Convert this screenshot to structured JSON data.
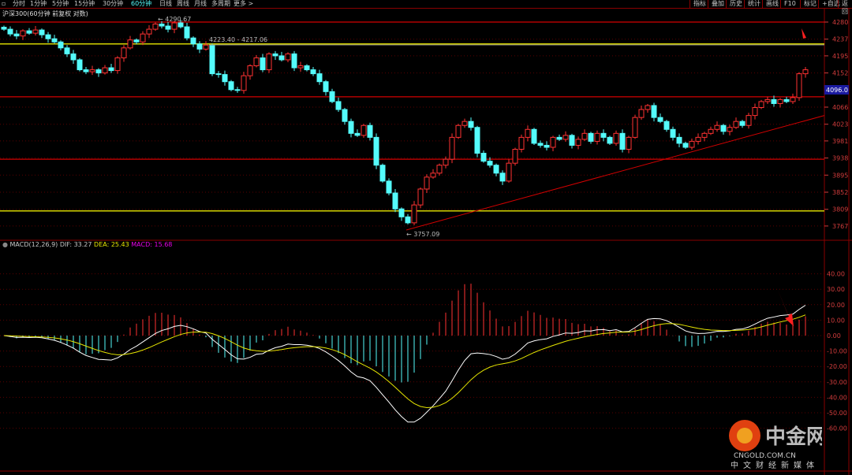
{
  "toolbar": {
    "periods": [
      "分时",
      "1分钟",
      "5分钟",
      "15分钟",
      "30分钟",
      "60分钟",
      "日线",
      "周线",
      "月线",
      "多周期",
      "更多 >"
    ],
    "active": "60分钟",
    "right": [
      "指标",
      "叠加",
      "历史",
      "统计",
      "画线",
      "F10",
      "标记",
      "+自选",
      "返回"
    ]
  },
  "title": "沪深300(60分钟 前复权 对数)",
  "macd_legend": {
    "name": "MACD(12,26,9)",
    "dif": "DIF: 33.27",
    "dea": "DEA: 25.43",
    "macd": "MACD: 15.68"
  },
  "colors": {
    "up": "#ff3232",
    "down": "#54fcfc",
    "dif": "#ffffff",
    "dea": "#e6e600",
    "level_yellow": "#d2d200",
    "level_red": "#d20000",
    "macd_label": "#e600e6"
  },
  "watermark": {
    "brand": "中金网",
    "domain": "CNGOLD.COM.CN",
    "tagline": "中文财经新媒体"
  },
  "chart_data": [
    {
      "type": "candlestick",
      "title": "沪深300(60分钟 前复权 对数)",
      "ylim": [
        3745,
        4300
      ],
      "yticks": [
        4280,
        4237,
        4195,
        4152,
        4066,
        4023,
        3981,
        3938,
        3895,
        3852,
        3809,
        3767
      ],
      "current_price_label": "4096.0",
      "annotations": {
        "high": "4290.67",
        "low": "3757.09",
        "range": "4223.40 - 4217.06"
      },
      "horizontal_levels": {
        "red": [
          4280,
          4092,
          3935
        ],
        "yellow": [
          4225,
          3805
        ]
      },
      "trendline": {
        "from_price": 3757,
        "to_price": 4045
      },
      "closes": [
        4262,
        4250,
        4245,
        4258,
        4252,
        4260,
        4248,
        4238,
        4230,
        4215,
        4200,
        4185,
        4160,
        4155,
        4160,
        4152,
        4165,
        4158,
        4190,
        4215,
        4235,
        4230,
        4250,
        4262,
        4275,
        4270,
        4262,
        4278,
        4268,
        4240,
        4225,
        4212,
        4222,
        4150,
        4148,
        4130,
        4110,
        4108,
        4145,
        4170,
        4190,
        4160,
        4200,
        4195,
        4185,
        4200,
        4165,
        4170,
        4160,
        4150,
        4130,
        4105,
        4080,
        4060,
        4030,
        4000,
        3995,
        4020,
        3990,
        3920,
        3880,
        3850,
        3810,
        3790,
        3775,
        3820,
        3860,
        3890,
        3900,
        3920,
        3935,
        3990,
        4020,
        4030,
        4015,
        3950,
        3930,
        3920,
        3900,
        3880,
        3925,
        3960,
        3990,
        4010,
        3975,
        3970,
        3965,
        3990,
        3985,
        3995,
        3970,
        3985,
        4000,
        3980,
        4000,
        3990,
        3975,
        4000,
        3960,
        3990,
        4040,
        4060,
        4070,
        4040,
        4030,
        4010,
        3990,
        3975,
        3965,
        3980,
        3990,
        4000,
        4010,
        4020,
        4005,
        4015,
        4030,
        4020,
        4045,
        4065,
        4080,
        4085,
        4075,
        4085,
        4080,
        4090,
        4150,
        4160
      ]
    },
    {
      "type": "macd",
      "params": [
        12,
        26,
        9
      ],
      "ylim": [
        -60,
        50
      ],
      "yticks": [
        "40.00",
        "30.00",
        "20.00",
        "10.00",
        "0.00",
        "-10.00",
        "-20.00",
        "-30.00",
        "-40.00",
        "-50.00",
        "-60.00"
      ],
      "last": {
        "dif": 33.27,
        "dea": 25.43,
        "macd": 15.68
      }
    }
  ]
}
